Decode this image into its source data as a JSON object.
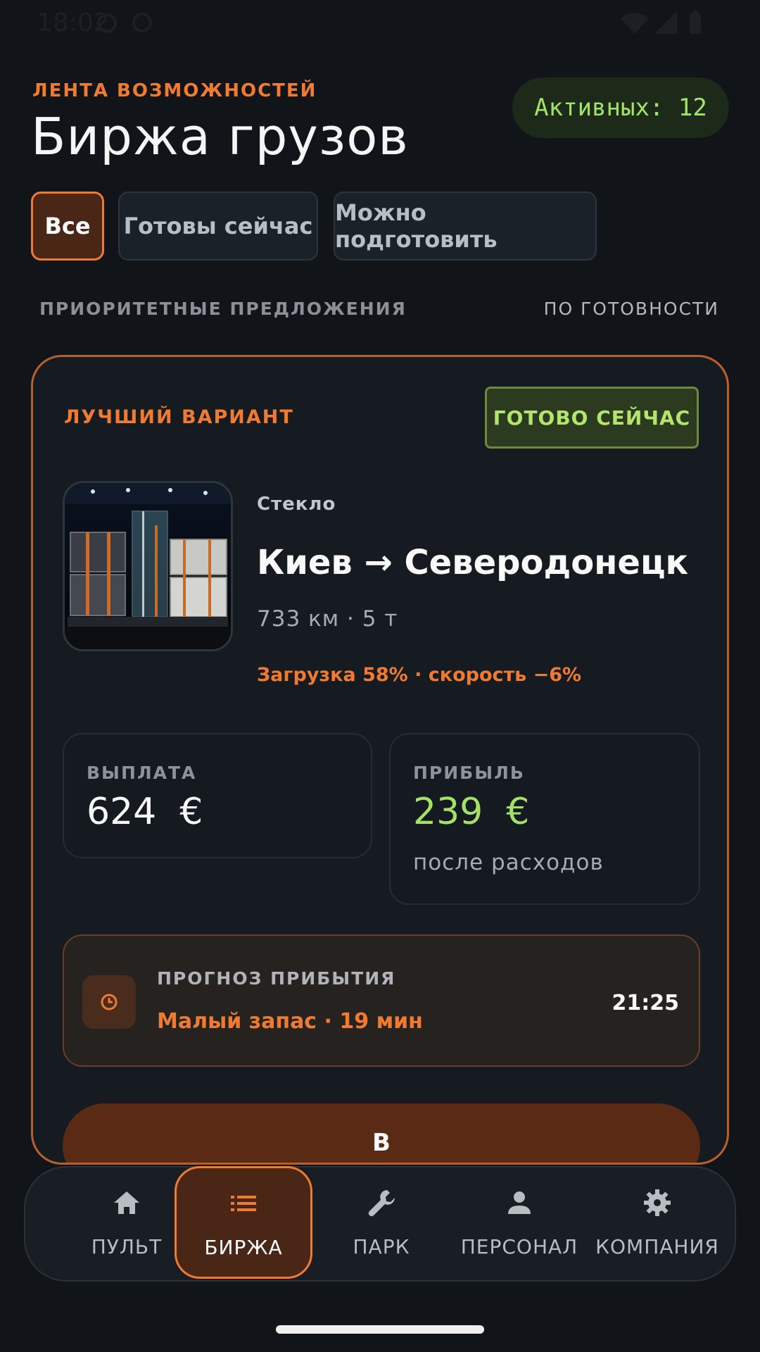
{
  "statusbar": {
    "time": "18:02"
  },
  "header": {
    "subtitle": "ЛЕНТА ВОЗМОЖНОСТЕЙ",
    "title": "Биржа грузов",
    "active_badge": "Активных: 12"
  },
  "filters": [
    {
      "label": "Все",
      "active": true
    },
    {
      "label": "Готовы сейчас",
      "active": false
    },
    {
      "label": "Можно подготовить",
      "active": false
    }
  ],
  "section": {
    "label": "ПРИОРИТЕТНЫЕ ПРЕДЛОЖЕНИЯ",
    "sort": "ПО ГОТОВНОСТИ"
  },
  "offer": {
    "tag": "ЛУЧШИЙ ВАРИАНТ",
    "ready_badge": "ГОТОВО СЕЙЧАС",
    "cargo_type": "Стекло",
    "route": "Киев → Северодонецк",
    "meta": "733 км · 5 т",
    "warning": "Загрузка 58% · скорость −6%",
    "payout": {
      "label": "ВЫПЛАТА",
      "value": "624  €"
    },
    "profit": {
      "label": "ПРИБЫЛЬ",
      "value": "239  €",
      "sub": "после расходов"
    },
    "eta": {
      "label": "ПРОГНОЗ ПРИБЫТИЯ",
      "status": "Малый запас · 19 мин",
      "time": "21:25"
    },
    "action_label": "В"
  },
  "nav": [
    {
      "label": "ПУЛЬТ",
      "icon": "home-icon",
      "active": false
    },
    {
      "label": "БИРЖА",
      "icon": "list-icon",
      "active": true
    },
    {
      "label": "ПАРК",
      "icon": "wrench-icon",
      "active": false
    },
    {
      "label": "ПЕРСОНАЛ",
      "icon": "person-icon",
      "active": false
    },
    {
      "label": "КОМПАНИЯ",
      "icon": "gear-icon",
      "active": false
    }
  ],
  "colors": {
    "accent": "#f07a30",
    "positive": "#a3e264",
    "background": "#111519"
  }
}
